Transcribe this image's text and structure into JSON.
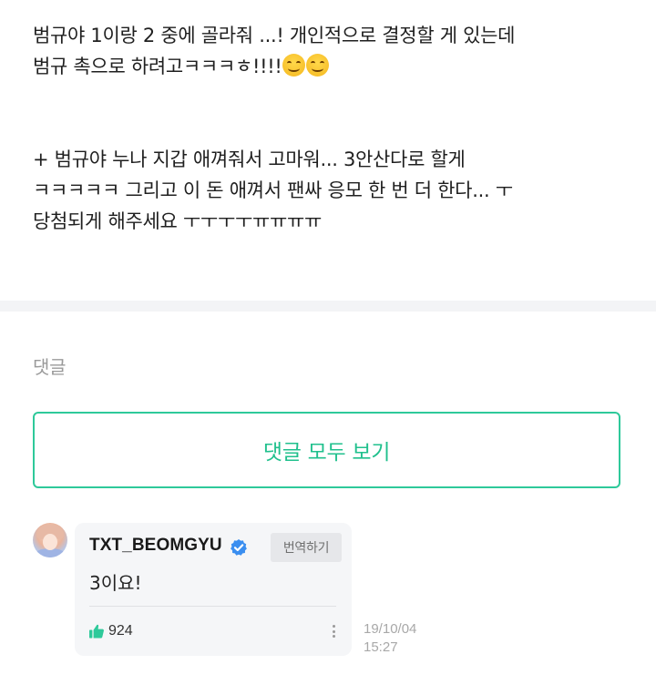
{
  "post": {
    "lines": [
      "범규야 1이랑 2 중에 골라줘 ...! 개인적으로 결정할 게 있는데",
      "범규 촉으로 하려고ㅋㅋㅋㅎ!!!!",
      "+ 범규야 누나 지갑 애껴줘서 고마워... 3안산다로 할게",
      "ㅋㅋㅋㅋㅋ 그리고 이 돈 애껴서 팬싸 응모 한 번 더 한다... ㅜ",
      "당첨되게 해주세요 ㅜㅜㅜㅜㅠㅠㅠㅠ"
    ],
    "emoji_icons": [
      "smiling-face-emoji",
      "smiling-face-emoji"
    ]
  },
  "comments": {
    "heading": "댓글",
    "view_all_label": "댓글 모두 보기",
    "accent_color": "#2ec99a",
    "items": [
      {
        "author": "TXT_BEOMGYU",
        "verified": true,
        "verified_color": "#3a8ef0",
        "translate_label": "번역하기",
        "text": "3이요!",
        "likes": "924",
        "date": "19/10/04",
        "time": "15:27"
      }
    ]
  }
}
